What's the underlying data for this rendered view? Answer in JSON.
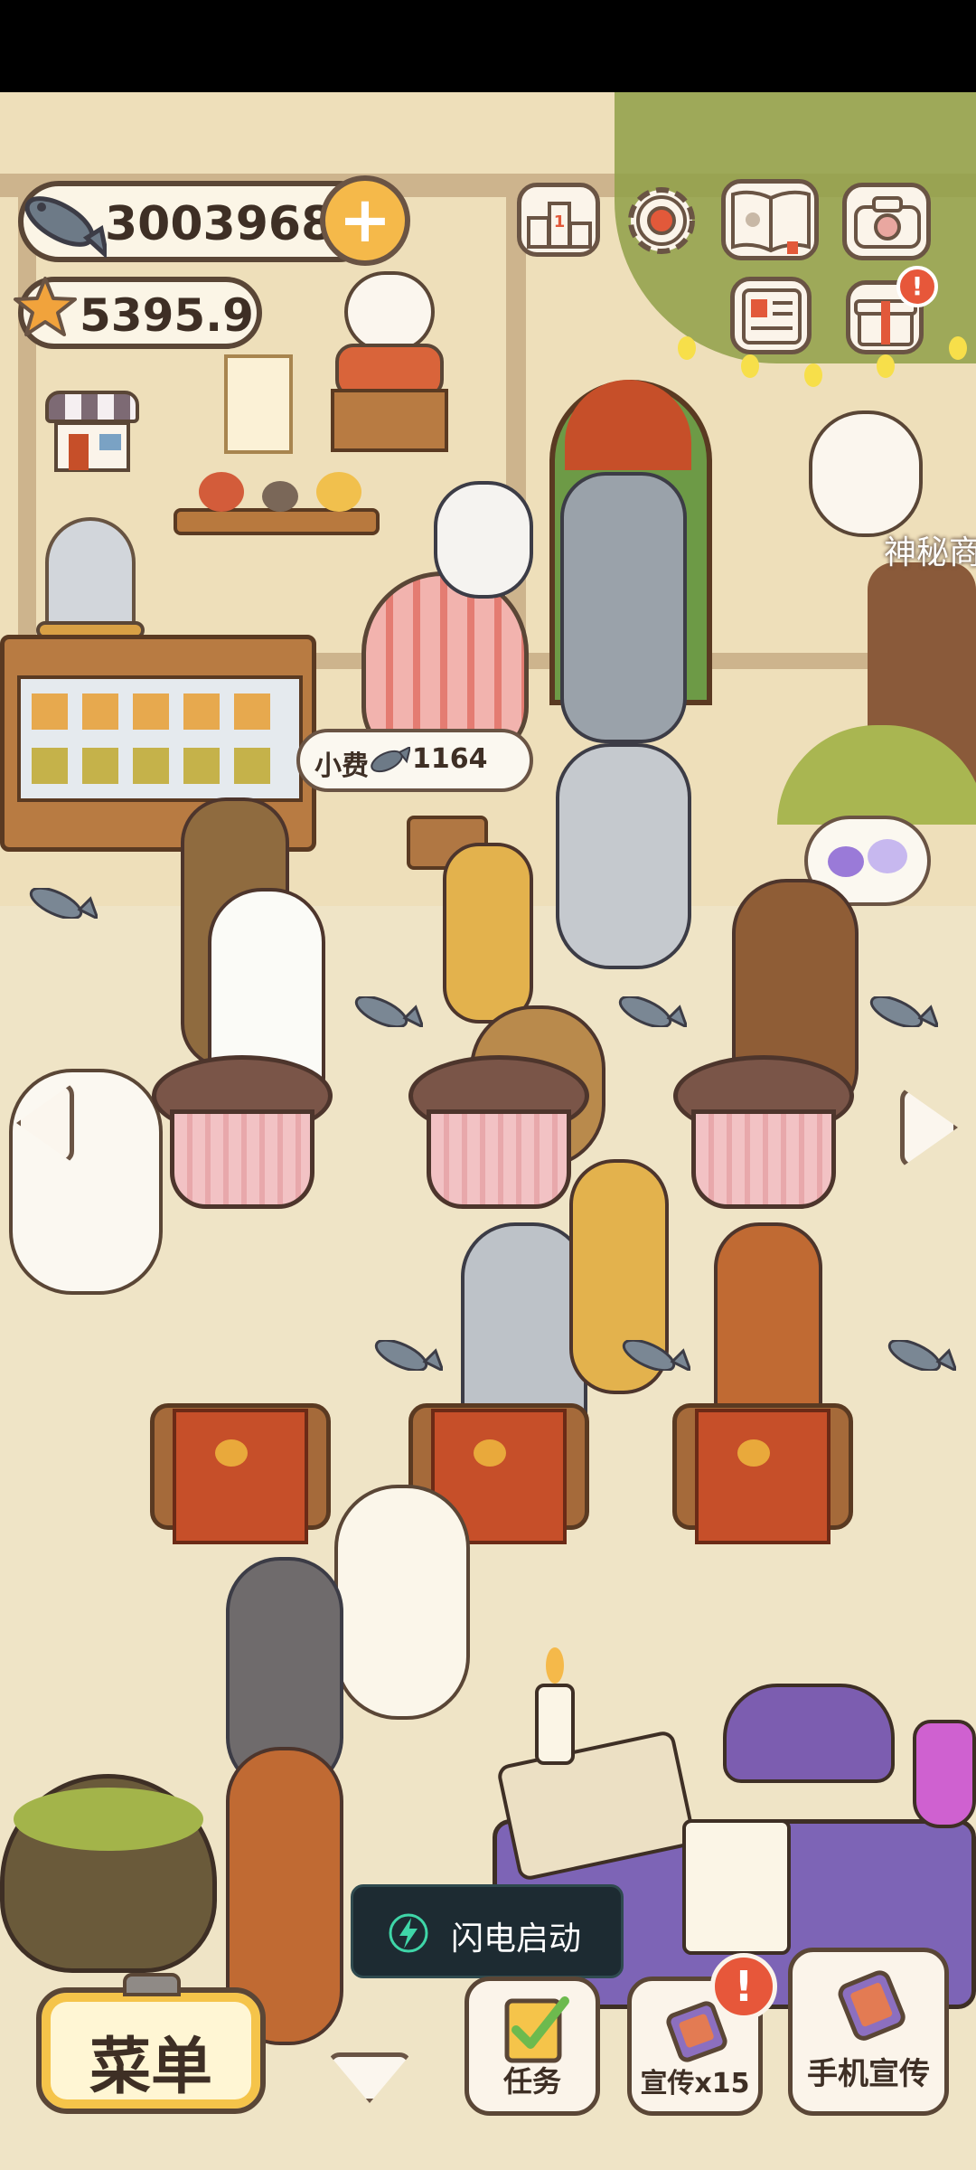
{
  "hud": {
    "fish_count": "3003968",
    "star_count": "5395.9",
    "plus_label": "+"
  },
  "scene": {
    "tip_label": "小费",
    "tip_value": "1164",
    "side_label": "神秘商"
  },
  "toast": {
    "text": "闪电启动"
  },
  "bottom_bar": {
    "menu_label": "菜单",
    "task_label": "任务",
    "promo_label": "宣传x15",
    "phone_promo_label": "手机宣传"
  },
  "colors": {
    "background": "#f0e3c3",
    "outline": "#5a4636",
    "accent_orange": "#f5b94a",
    "alert_red": "#e7573a"
  }
}
